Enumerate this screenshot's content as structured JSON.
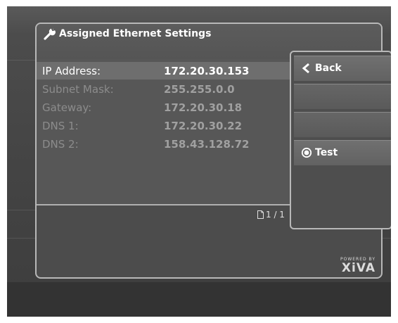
{
  "dialog": {
    "title": "Assigned Ethernet Settings",
    "title_icon": "wrench-icon"
  },
  "settings": [
    {
      "label": "IP Address:",
      "value": "172.20.30.153",
      "selected": true
    },
    {
      "label": "Subnet Mask:",
      "value": "255.255.0.0",
      "selected": false
    },
    {
      "label": "Gateway:",
      "value": "172.20.30.18",
      "selected": false
    },
    {
      "label": "DNS 1:",
      "value": "172.20.30.22",
      "selected": false
    },
    {
      "label": "DNS 2:",
      "value": "158.43.128.72",
      "selected": false
    }
  ],
  "pagination": {
    "text": "1 / 1",
    "icon": "page-icon"
  },
  "menu": {
    "back_label": "Back",
    "back_icon": "chevron-left-icon",
    "test_label": "Test",
    "test_icon": "radio-selected-icon"
  },
  "brand": {
    "powered_by": "POWERED BY",
    "logo": "XiVA"
  },
  "colors": {
    "text_primary": "#ffffff",
    "text_dim": "#8c8c8c",
    "border": "#b8b8b8",
    "background": "#4c4c4c"
  }
}
